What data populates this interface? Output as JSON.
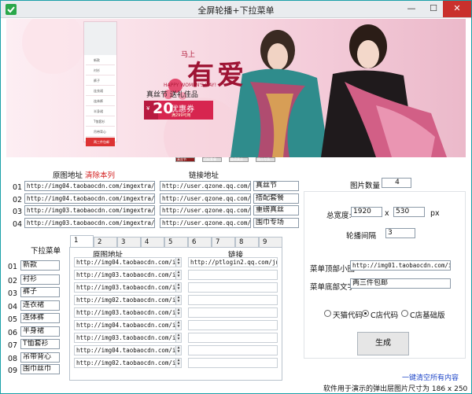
{
  "window": {
    "title": "全屏轮播+下拉菜单",
    "minimize": "—",
    "maximize": "☐",
    "close": "✕"
  },
  "banner": {
    "side_menu": [
      "新款",
      "衬衫",
      "裤子",
      "连衣裙",
      "连体裤",
      "半身裙",
      "T恤套衫",
      "吊带背心",
      "围巾丝巾",
      "两三件包邮"
    ],
    "headline": "有爱",
    "headline_small": "马上",
    "sub_en": "HAPPY WOMEN'S DAY!",
    "slogan": "真丝节 送礼佳品",
    "coupon_prefix": "¥",
    "coupon_value": "20",
    "coupon_text": "优惠券",
    "coupon_sub": "满299可用",
    "dots": [
      "真丝节",
      "搭配套餐",
      "重磅真丝",
      "围巾专场"
    ]
  },
  "images_section": {
    "header_addr": "原图地址",
    "header_clear": "清除本列",
    "header_link": "链接地址",
    "rows": [
      {
        "no": "01",
        "src": "http://img04.taobaocdn.com/imgextra/i4/7",
        "link": "http://user.qzone.qq.com/1",
        "name": "真丝节"
      },
      {
        "no": "02",
        "src": "http://img04.taobaocdn.com/imgextra/i4/7",
        "link": "http://user.qzone.qq.com/1",
        "name": "搭配套餐"
      },
      {
        "no": "03",
        "src": "http://img03.taobaocdn.com/imgextra/i3/7",
        "link": "http://user.qzone.qq.com/1",
        "name": "重磅真丝"
      },
      {
        "no": "04",
        "src": "http://img03.taobaocdn.com/imgextra/i3/7",
        "link": "http://user.qzone.qq.com/1",
        "name": "围巾专场"
      }
    ]
  },
  "settings": {
    "count_label": "图片数量",
    "count_value": "4",
    "width_label": "总宽度:",
    "width_value": "1920",
    "times": "x",
    "height_value": "530",
    "unit": "px",
    "interval_label": "轮播间隔",
    "interval_value": "3",
    "top_img_label": "菜单顶部小图",
    "top_img_value": "http://img01.taobaocdn.com/imge",
    "bottom_text_label": "菜单底部文字",
    "bottom_text_value": "两三件包邮",
    "radios": [
      "天猫代码",
      "C店代码",
      "C店基础版"
    ],
    "generate": "生成"
  },
  "menu_section": {
    "title": "下拉菜单",
    "tabs": [
      "1",
      "2",
      "3",
      "4",
      "5",
      "6",
      "7",
      "8",
      "9"
    ],
    "col_img": "原图地址",
    "col_link": "链接",
    "items": [
      {
        "no": "01",
        "name": "新款",
        "img": "http://img04.taobaocdn.com/imge",
        "link": "http://ptlogin2.qq.com/jum"
      },
      {
        "no": "02",
        "name": "衬衫",
        "img": "http://img03.taobaocdn.com/imge",
        "link": ""
      },
      {
        "no": "03",
        "name": "裤子",
        "img": "http://img03.taobaocdn.com/imge",
        "link": ""
      },
      {
        "no": "04",
        "name": "连衣裙",
        "img": "http://img02.taobaocdn.com/imge",
        "link": ""
      },
      {
        "no": "05",
        "name": "连体裤",
        "img": "http://img03.taobaocdn.com/imge",
        "link": ""
      },
      {
        "no": "06",
        "name": "半身裙",
        "img": "http://img04.taobaocdn.com/imge",
        "link": ""
      },
      {
        "no": "07",
        "name": "T恤套衫",
        "img": "http://img03.taobaocdn.com/imge",
        "link": ""
      },
      {
        "no": "08",
        "name": "吊带背心",
        "img": "http://img04.taobaocdn.com/imge",
        "link": ""
      },
      {
        "no": "09",
        "name": "围巾丝巾",
        "img": "http://img02.taobaocdn.com/imge",
        "link": ""
      }
    ]
  },
  "footer": {
    "clear_all": "一键清空所有内容",
    "hint": "软件用于演示的弹出层图片尺寸为 186 x 250"
  },
  "colors": {
    "accent_red": "#d21b1b",
    "link_blue": "#1f47c8",
    "close_red": "#c9302c",
    "banner_pink": "#f3cad8"
  }
}
